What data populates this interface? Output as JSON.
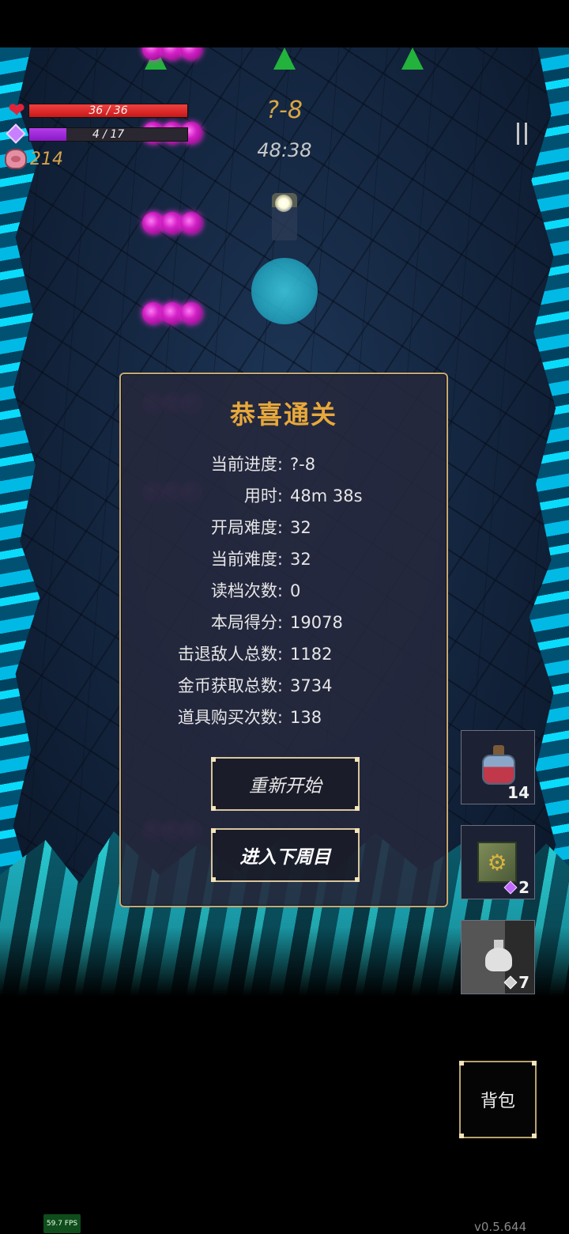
{
  "hud": {
    "hp_text": "36 / 36",
    "hp_fraction": 1.0,
    "mp_text": "4 / 17",
    "mp_fraction": 0.235,
    "gold": "214",
    "stage": "?-8",
    "timer": "48:38"
  },
  "icons": {
    "hp": "heart-icon",
    "mp": "gem-icon",
    "gold": "pig-icon",
    "pause": "pause-icon"
  },
  "dialog": {
    "title": "恭喜通关",
    "stats": [
      {
        "label": "当前进度:",
        "value": "?-8"
      },
      {
        "label": "用时:",
        "value": "48m 38s"
      },
      {
        "label": "开局难度:",
        "value": "32"
      },
      {
        "label": "当前难度:",
        "value": "32"
      },
      {
        "label": "读档次数:",
        "value": "0"
      },
      {
        "label": "本局得分:",
        "value": "19078"
      },
      {
        "label": "击退敌人总数:",
        "value": "1182"
      },
      {
        "label": "金币获取总数:",
        "value": "3734"
      },
      {
        "label": "道具购买次数:",
        "value": "138"
      }
    ],
    "restart_label": "重新开始",
    "next_cycle_label": "进入下周目"
  },
  "items": [
    {
      "icon": "potion-icon",
      "count": "14"
    },
    {
      "icon": "cube-icon",
      "count": "2",
      "cost_gem": "purple"
    },
    {
      "icon": "vase-icon",
      "count": "7",
      "cost_gem": "grey"
    }
  ],
  "backpack_label": "背包",
  "fps": "59.7 FPS",
  "version": "v0.5.644",
  "colors": {
    "hp": "#d42a2a",
    "mp": "#a02ad8",
    "gold_text": "#d8a24b",
    "dialog_title": "#e8a83a",
    "dialog_border": "#c7a873",
    "enemy": "#d020c4",
    "marker": "#23b23c"
  }
}
